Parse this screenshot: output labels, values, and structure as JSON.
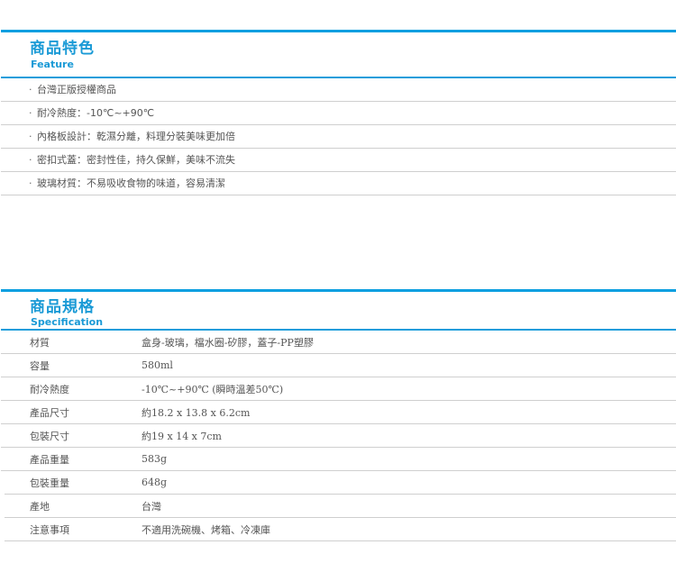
{
  "feature": {
    "title": "商品特色",
    "subtitle": "Feature",
    "bullet": "·",
    "items": [
      "台灣正版授權商品",
      "耐冷熱度：-10℃~+90℃",
      "內格板設計：乾濕分離，料理分裝美味更加倍",
      "密扣式蓋：密封性佳，持久保鮮，美味不流失",
      "玻璃材質：不易吸收食物的味道，容易清潔"
    ]
  },
  "spec": {
    "title": "商品規格",
    "subtitle": "Specification",
    "rows": [
      {
        "label": "材質",
        "value": "盒身-玻璃，檔水圈-矽膠，蓋子-PP塑膠"
      },
      {
        "label": "容量",
        "value": "580ml"
      },
      {
        "label": "耐冷熱度",
        "value": "-10℃~+90℃ (瞬時溫差50℃)"
      },
      {
        "label": "產品尺寸",
        "value": "約18.2 x 13.8 x 6.2cm"
      },
      {
        "label": "包裝尺寸",
        "value": "約19 x 14 x 7cm"
      },
      {
        "label": "產品重量",
        "value": "583g"
      },
      {
        "label": "包裝重量",
        "value": "648g"
      },
      {
        "label": "產地",
        "value": "台灣"
      },
      {
        "label": "注意事項",
        "value": "不適用洗碗機、烤箱、冷凍庫"
      }
    ]
  },
  "colors": {
    "accent": "#1a9ad6",
    "divider": "#cfcfcf",
    "text": "#555555"
  }
}
